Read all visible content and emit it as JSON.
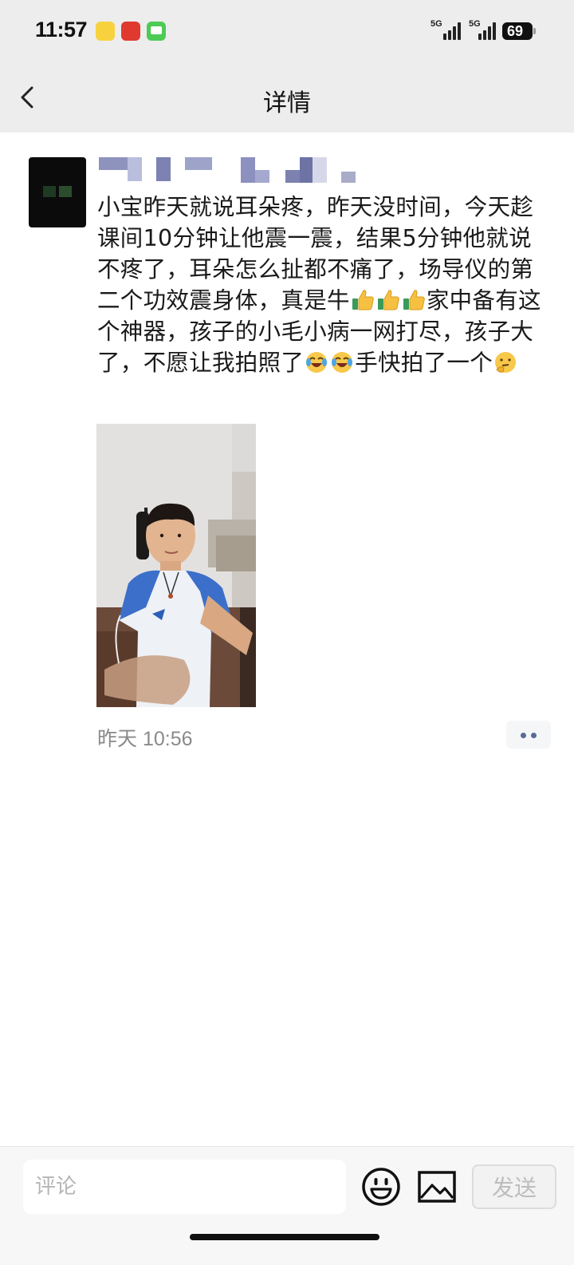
{
  "status_bar": {
    "time": "11:57",
    "network_1": "5G",
    "network_2": "5G",
    "battery": "69"
  },
  "nav": {
    "title": "详情",
    "back_icon": "chevron-left-icon"
  },
  "post": {
    "text_parts": [
      "小宝昨天就说耳朵疼，昨天没时间，今天趁课间10分钟让他震一震，结果5分钟他就说不疼了，耳朵怎么扯都不痛了，场导仪的第二个功效震身体，真是牛",
      "家中备有这个神器，孩子的小毛小病一网打尽，孩子大了，不愿让我拍照了",
      "手快拍了一个"
    ],
    "emojis": [
      "thumbs-up-icon",
      "thumbs-up-icon",
      "thumbs-up-icon",
      "laughing-crying-icon",
      "laughing-crying-icon",
      "thinking-face-icon"
    ],
    "timestamp": "昨天 10:56"
  },
  "comment_bar": {
    "placeholder": "评论",
    "emoji_icon": "smiley-icon",
    "image_icon": "image-icon",
    "send_label": "发送"
  },
  "colors": {
    "header_bg": "#ededed",
    "link_blue": "#576b95",
    "timestamp_gray": "#8a8a8a"
  }
}
